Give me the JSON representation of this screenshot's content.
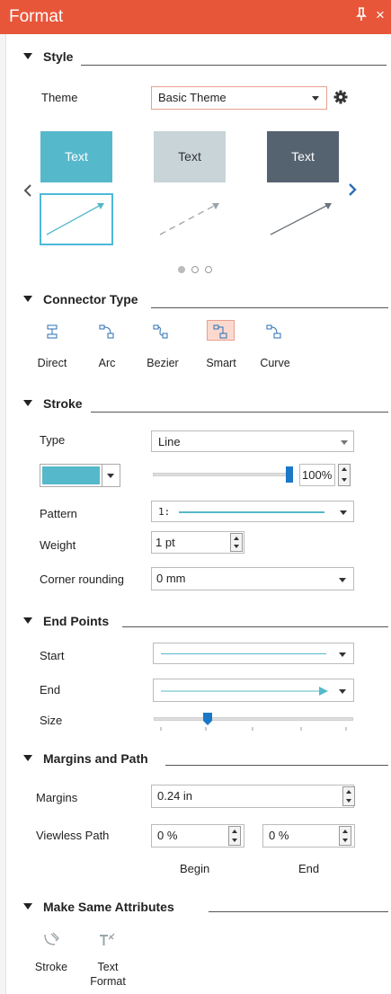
{
  "panel": {
    "title": "Format",
    "pin_glyph": "p",
    "close_glyph": "×"
  },
  "style": {
    "header": "Style",
    "theme_label": "Theme",
    "theme_value": "Basic Theme",
    "cards": [
      "Text",
      "Text",
      "Text"
    ],
    "card_colors": [
      "#56b8cb",
      "#c8d4d8",
      "#556270"
    ],
    "pager": {
      "current": 1,
      "total": 3
    }
  },
  "connector": {
    "header": "Connector Type",
    "items": [
      "Direct",
      "Arc",
      "Bezier",
      "Smart",
      "Curve"
    ],
    "selected": "Smart"
  },
  "stroke": {
    "header": "Stroke",
    "type_label": "Type",
    "type_value": "Line",
    "color": "#56b8cb",
    "opacity_value": "100%",
    "opacity_level": 1.0,
    "pattern_label": "Pattern",
    "pattern_prefix": "1:",
    "weight_label": "Weight",
    "weight_value": "1 pt",
    "rounding_label": "Corner rounding",
    "rounding_value": "0 mm"
  },
  "end_points": {
    "header": "End Points",
    "start_label": "Start",
    "end_label": "End",
    "size_label": "Size",
    "size_level": 0.25
  },
  "margins": {
    "header": "Margins and Path",
    "margins_label": "Margins",
    "margins_value": "0.24 in",
    "viewless_label": "Viewless Path",
    "begin_value": "0 %",
    "end_value": "0 %",
    "begin_label": "Begin",
    "end_label": "End"
  },
  "same_attr": {
    "header": "Make Same Attributes",
    "stroke_label": "Stroke",
    "text_label_line1": "Text",
    "text_label_line2": "Format"
  }
}
